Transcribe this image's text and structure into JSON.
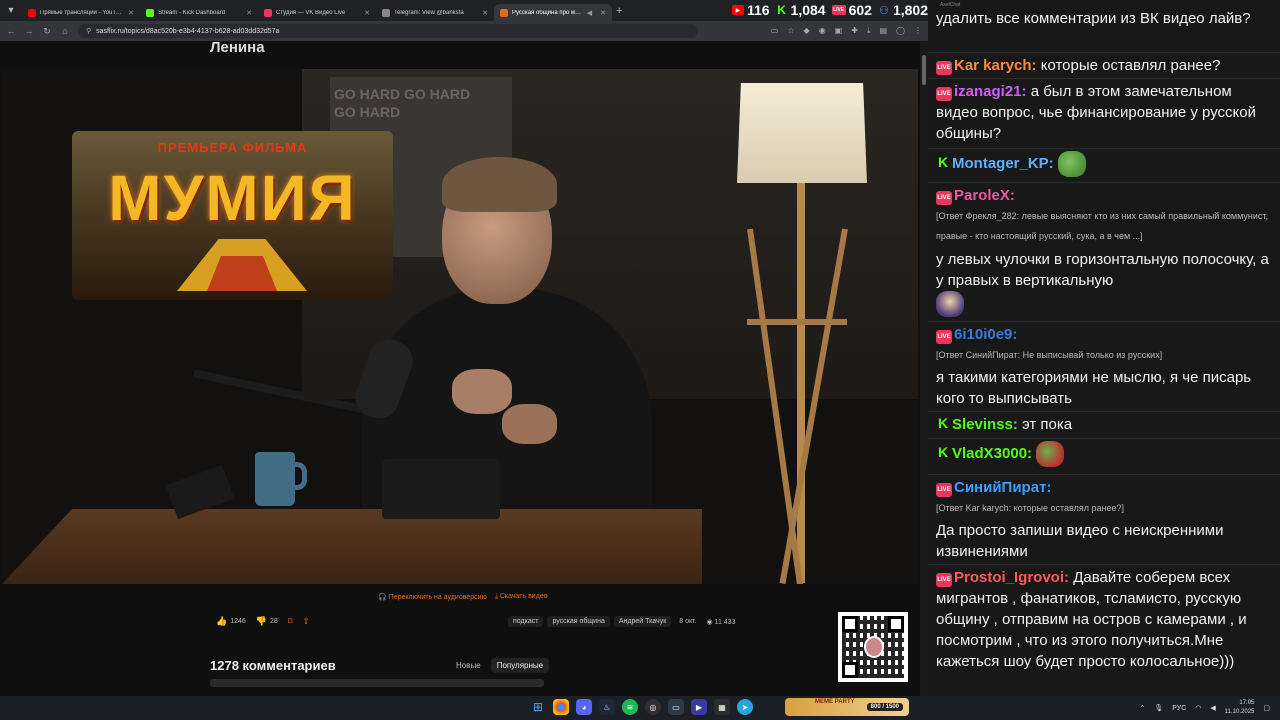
{
  "browser": {
    "tabs": [
      {
        "label": "Прямые трансляции - YouTube",
        "color": "#ff0000",
        "active": false
      },
      {
        "label": "Stream - Kick Dashboard",
        "color": "#53fc18",
        "active": false
      },
      {
        "label": "Студия — VK Видео Live",
        "color": "#e8375a",
        "active": false
      },
      {
        "label": "Telegram: View @banksta",
        "color": "#888888",
        "active": false
      },
      {
        "label": "Русская община про миг…",
        "color": "#e06a1c",
        "active": true
      }
    ],
    "url": "sasflix.ru/topics/d8ac520b-e3b4-4137-b628-ad03dd32d57a"
  },
  "stats": [
    {
      "icon": "youtube-icon",
      "value": "116",
      "color": "#ff0000",
      "glyph": "▶"
    },
    {
      "icon": "kick-icon",
      "value": "1,084",
      "color": "#53fc18",
      "glyph": "K"
    },
    {
      "icon": "vk-live-icon",
      "value": "602",
      "color": "#e8375a",
      "glyph": "LIVE"
    },
    {
      "icon": "viewers-icon",
      "value": "1,802",
      "color": "#4aa3ff",
      "glyph": "👥"
    }
  ],
  "page": {
    "title": "Ленина",
    "overlay": {
      "premiere": "ПРЕМЬЕРА ФИЛЬМА",
      "title": "МУМИЯ"
    },
    "links": {
      "audio": "Переключить на аудиоверсию",
      "download": "Скачать видео"
    },
    "likes": "1246",
    "dislikes": "28",
    "tags": [
      "подкаст",
      "русская община",
      "Андрей Ткачук"
    ],
    "date": "8 окт.",
    "views": "11 433",
    "comments_title": "1278 комментариев",
    "sort": {
      "new": "Новые",
      "popular": "Популярные"
    }
  },
  "chat": {
    "window_title": "AxelChat",
    "messages": [
      {
        "platform": "",
        "user": "",
        "color": "#ffffff",
        "reply": "",
        "text": "удалить все комментарии из ВК видео лайв?"
      },
      {
        "platform": "vk",
        "user": "Kar karych:",
        "color": "#ff8a3d",
        "reply": "",
        "text": "которые оставлял ранее?"
      },
      {
        "platform": "vk",
        "user": "izanagi21:",
        "color": "#d15cff",
        "reply": "",
        "text": "а был в этом замечательном видео вопрос, чье финансирование у русской общины?"
      },
      {
        "platform": "kick",
        "user": "Montager_KP:",
        "color": "#5fb0ff",
        "reply": "",
        "text": ""
      },
      {
        "platform": "vk",
        "user": "ParoleX:",
        "color": "#e85aa0",
        "reply": "[Ответ Фрекля_282: левые выясняют кто из них самый правильный коммунист, правые - кто настоящий русский, сука, а в чем ...]",
        "text": "у левых чулочки в горизонтальную полосочку, а у правых в вертикальную"
      },
      {
        "platform": "vk",
        "user": "6i10i0e9:",
        "color": "#3a7ad8",
        "reply": "[Ответ СинийПират: Не выписывай только из русских]",
        "text": "я такими категориями не мыслю, я че писарь кого то выписывать"
      },
      {
        "platform": "kick",
        "user": "Slevinss:",
        "color": "#53fc18",
        "reply": "",
        "text": "эт пока"
      },
      {
        "platform": "kick",
        "user": "VladX3000:",
        "color": "#53fc18",
        "reply": "",
        "text": ""
      },
      {
        "platform": "vk",
        "user": "СинийПират:",
        "color": "#3aa0ff",
        "reply": "[Ответ Kar karych: которые оставлял ранее?]",
        "text": "Да просто запиши видео с неискренними извинениями"
      },
      {
        "platform": "vk",
        "user": "Prostoi_Igrovoi:",
        "color": "#ff5a5a",
        "reply": "",
        "text": "Давайте соберем всех мигрантов , фанатиков, тсламисто, русскую общину , отправим на остров с камерами , и посмотрим , что из этого получиться.Мне кажеться шоу будет просто колосальное)))"
      }
    ]
  },
  "taskbar": {
    "widget_title": "MEME PARTY",
    "widget_count": "800 / 1500",
    "lang": "РУС",
    "time": "17:05",
    "date": "11.10.2025"
  }
}
